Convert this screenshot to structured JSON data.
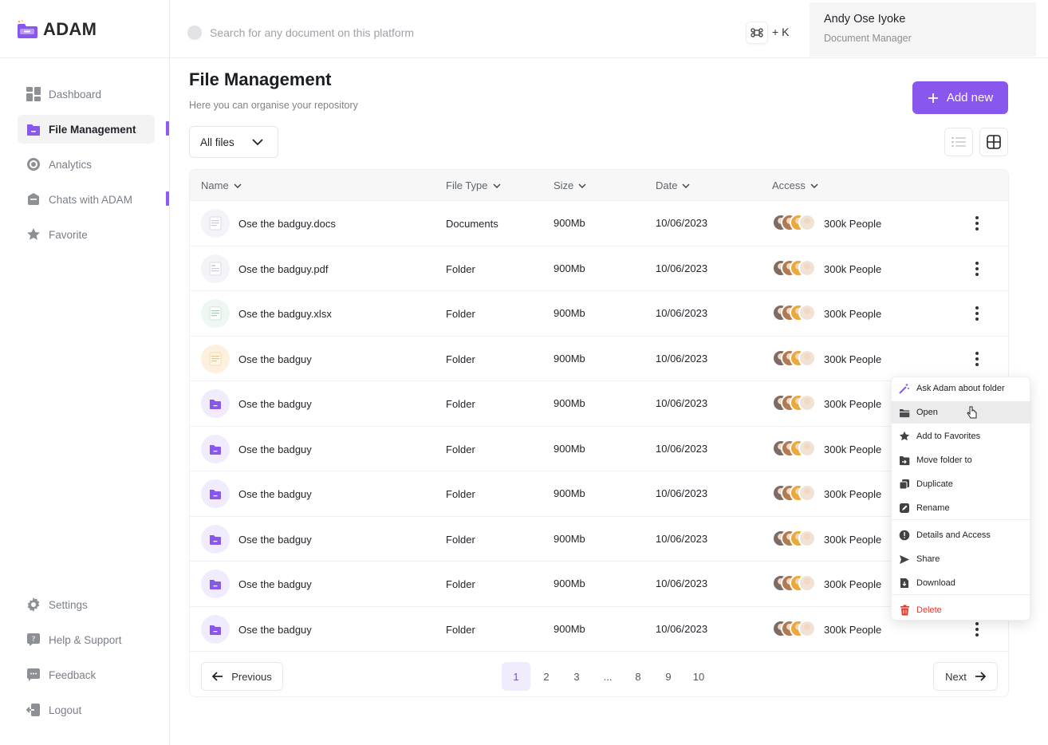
{
  "brand": {
    "name": "ADAM"
  },
  "colors": {
    "accent": "#8a57ee",
    "danger": "#e0392b",
    "sidebar_active_bg": "#f3f3f4"
  },
  "sidebar": {
    "items": [
      {
        "label": "Dashboard",
        "icon": "dashboard-grid-icon",
        "active": false
      },
      {
        "label": "File Management",
        "icon": "folder-icon",
        "active": true
      },
      {
        "label": "Analytics",
        "icon": "analytics-ring-icon",
        "active": false
      },
      {
        "label": "Chats with ADAM",
        "icon": "chat-box-icon",
        "active": false
      },
      {
        "label": "Favorite",
        "icon": "star-icon",
        "active": false
      }
    ],
    "bottom_items": [
      {
        "label": "Settings",
        "icon": "gear-icon"
      },
      {
        "label": "Help & Support",
        "icon": "help-icon"
      },
      {
        "label": "Feedback",
        "icon": "feedback-icon"
      },
      {
        "label": "Logout",
        "icon": "logout-icon"
      }
    ]
  },
  "header": {
    "search_placeholder": "Search for any document on this platform",
    "shortcut": "+ K",
    "user": {
      "name": "Andy Ose Iyoke",
      "role": "Document Manager"
    }
  },
  "main": {
    "title": "File Management",
    "subtitle": "Here you can organise your repository",
    "add_button": "Add new",
    "filter": "All files"
  },
  "table": {
    "columns": [
      "Name",
      "File Type",
      "Size",
      "Date",
      "Access"
    ],
    "rows": [
      {
        "name": "Ose the badguy.docs",
        "type": "Documents",
        "size": "900Mb",
        "date": "10/06/2023",
        "access": "300k People",
        "icon": "doc-file-icon"
      },
      {
        "name": "Ose the badguy.pdf",
        "type": "Folder",
        "size": "900Mb",
        "date": "10/06/2023",
        "access": "300k People",
        "icon": "pdf-file-icon"
      },
      {
        "name": "Ose the badguy.xlsx",
        "type": "Folder",
        "size": "900Mb",
        "date": "10/06/2023",
        "access": "300k People",
        "icon": "xlsx-file-icon"
      },
      {
        "name": "Ose the badguy",
        "type": "Folder",
        "size": "900Mb",
        "date": "10/06/2023",
        "access": "300k People",
        "icon": "note-file-icon"
      },
      {
        "name": "Ose the badguy",
        "type": "Folder",
        "size": "900Mb",
        "date": "10/06/2023",
        "access": "300k People",
        "icon": "folder-icon"
      },
      {
        "name": "Ose the badguy",
        "type": "Folder",
        "size": "900Mb",
        "date": "10/06/2023",
        "access": "300k People",
        "icon": "folder-icon"
      },
      {
        "name": "Ose the badguy",
        "type": "Folder",
        "size": "900Mb",
        "date": "10/06/2023",
        "access": "300k People",
        "icon": "folder-icon"
      },
      {
        "name": "Ose the badguy",
        "type": "Folder",
        "size": "900Mb",
        "date": "10/06/2023",
        "access": "300k People",
        "icon": "folder-icon"
      },
      {
        "name": "Ose the badguy",
        "type": "Folder",
        "size": "900Mb",
        "date": "10/06/2023",
        "access": "300k People",
        "icon": "folder-icon"
      },
      {
        "name": "Ose the badguy",
        "type": "Folder",
        "size": "900Mb",
        "date": "10/06/2023",
        "access": "300k People",
        "icon": "folder-icon"
      }
    ]
  },
  "pagination": {
    "previous": "Previous",
    "next": "Next",
    "pages": [
      "1",
      "2",
      "3",
      "...",
      "8",
      "9",
      "10"
    ],
    "current": "1"
  },
  "context_menu": {
    "items": [
      {
        "label": "Ask Adam about folder",
        "icon": "magic-wand-icon"
      },
      {
        "label": "Open",
        "icon": "open-folder-icon",
        "hover": true
      },
      {
        "label": "Add to Favorites",
        "icon": "star-icon"
      },
      {
        "label": "Move folder  to",
        "icon": "move-icon"
      },
      {
        "label": "Duplicate",
        "icon": "duplicate-icon"
      },
      {
        "label": "Rename",
        "icon": "rename-icon"
      },
      {
        "label": "Details and Access",
        "icon": "info-icon"
      },
      {
        "label": "Share",
        "icon": "share-icon"
      },
      {
        "label": "Download",
        "icon": "download-icon"
      },
      {
        "label": "Delete",
        "icon": "trash-icon",
        "danger": true
      }
    ]
  }
}
